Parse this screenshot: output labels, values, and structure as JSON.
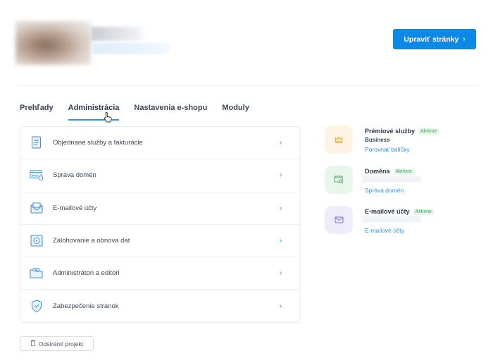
{
  "header": {
    "edit_button": "Upraviť stránky",
    "edit_chevron": "›"
  },
  "tabs": [
    {
      "label": "Prehľady"
    },
    {
      "label": "Administrácia",
      "active": true
    },
    {
      "label": "Nastavenia e-shopu"
    },
    {
      "label": "Moduly"
    }
  ],
  "menu": {
    "items": [
      {
        "label": "Objednané služby a fakturácie",
        "icon": "document-icon"
      },
      {
        "label": "Správa domén",
        "icon": "domain-window-icon"
      },
      {
        "label": "E-mailové účty",
        "icon": "mail-icon"
      },
      {
        "label": "Zálohovanie a obnova dát",
        "icon": "safe-icon"
      },
      {
        "label": "Administrátori a editori",
        "icon": "folder-users-icon"
      },
      {
        "label": "Zabezpečenie stránok",
        "icon": "shield-icon"
      }
    ],
    "chevron": "›"
  },
  "services": {
    "premium": {
      "title": "Prémiové služby",
      "status": "Aktívne",
      "plan": "Business",
      "link": "Porovnať balíčky",
      "icon": "crown-icon",
      "color": "#fdf4e3"
    },
    "domain": {
      "title": "Doména",
      "status": "Aktívne",
      "link": "Správa domén",
      "icon": "domain-search-icon",
      "color": "#e8f6ec"
    },
    "email": {
      "title": "E-mailové účty",
      "status": "Aktívne",
      "link": "E-mailové účty",
      "icon": "envelope-icon",
      "color": "#efedfb"
    }
  },
  "footer": {
    "delete_button": "Odstrániť projekt"
  },
  "colors": {
    "accent": "#0a8ae6",
    "link": "#2f93e6",
    "active_green": "#3fa25a"
  }
}
